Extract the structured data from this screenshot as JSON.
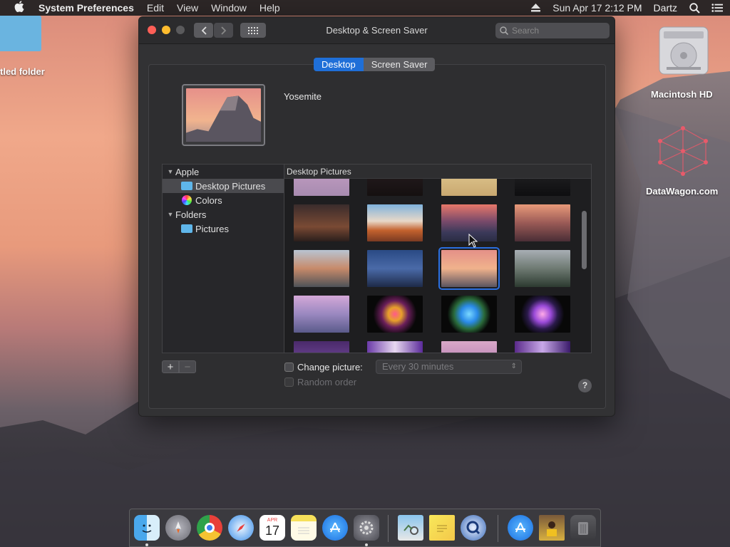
{
  "menubar": {
    "app_name": "System Preferences",
    "menus": [
      "Edit",
      "View",
      "Window",
      "Help"
    ],
    "clock": "Sun Apr 17  2:12 PM",
    "user": "Dartz"
  },
  "desktop": {
    "folder_label": "tled folder",
    "hd_label": "Macintosh HD",
    "logo_label": "DataWagon.com"
  },
  "window": {
    "title": "Desktop & Screen Saver",
    "search_placeholder": "Search",
    "tabs": [
      {
        "label": "Desktop",
        "active": true
      },
      {
        "label": "Screen Saver",
        "active": false
      }
    ],
    "current_picture": "Yosemite",
    "sidebar": {
      "groups": [
        {
          "label": "Apple",
          "items": [
            "Desktop Pictures",
            "Colors"
          ]
        },
        {
          "label": "Folders",
          "items": [
            "Pictures"
          ]
        }
      ]
    },
    "grid_header": "Desktop Pictures",
    "change_picture_label": "Change picture:",
    "interval_value": "Every 30 minutes",
    "random_order_label": "Random order",
    "help_label": "?",
    "plus_label": "+",
    "minus_label": "−"
  },
  "dock": {
    "apps": [
      "finder",
      "launchpad",
      "chrome",
      "safari",
      "calendar",
      "notes",
      "app-store",
      "system-preferences",
      "preview",
      "stickies",
      "quicktime",
      "app-store-downloads",
      "photo",
      "trash"
    ],
    "calendar_month": "APR",
    "calendar_day": "17"
  },
  "colors": {
    "accent": "#1f6fd8",
    "selection_outline": "#2a6fe0"
  }
}
